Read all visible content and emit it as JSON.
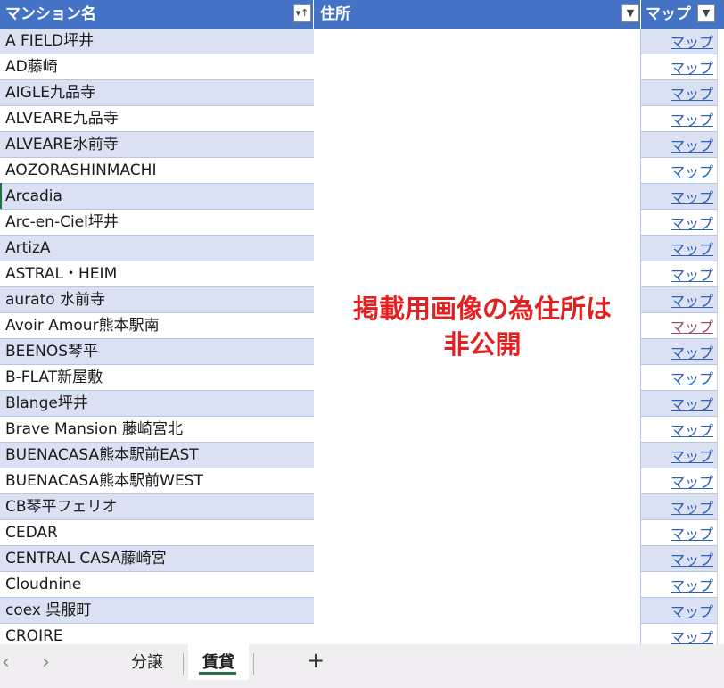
{
  "headers": {
    "name": "マンション名",
    "address": "住所",
    "map": "マップ"
  },
  "filter_icons": {
    "name": "filter-sort-ascending-icon",
    "address": "dropdown-arrow-icon",
    "map": "dropdown-arrow-icon"
  },
  "rows": [
    {
      "name": "A FIELD坪井",
      "map": "マップ"
    },
    {
      "name": "AD藤崎",
      "map": "マップ"
    },
    {
      "name": "AIGLE九品寺",
      "map": "マップ"
    },
    {
      "name": "ALVEARE九品寺",
      "map": "マップ"
    },
    {
      "name": "ALVEARE水前寺",
      "map": "マップ"
    },
    {
      "name": "AOZORASHINMACHI",
      "map": "マップ"
    },
    {
      "name": "Arcadia",
      "map": "マップ"
    },
    {
      "name": "Arc-en-Ciel坪井",
      "map": "マップ"
    },
    {
      "name": "ArtizA",
      "map": "マップ"
    },
    {
      "name": "ASTRAL・HEIM",
      "map": "マップ"
    },
    {
      "name": "aurato 水前寺",
      "map": "マップ"
    },
    {
      "name": "Avoir Amour熊本駅南",
      "map": "マップ",
      "visited": true
    },
    {
      "name": "BEENOS琴平",
      "map": "マップ"
    },
    {
      "name": "B-FLAT新屋敷",
      "map": "マップ"
    },
    {
      "name": "Blange坪井",
      "map": "マップ"
    },
    {
      "name": "Brave Mansion 藤崎宮北",
      "map": "マップ"
    },
    {
      "name": "BUENACASA熊本駅前EAST",
      "map": "マップ"
    },
    {
      "name": "BUENACASA熊本駅前WEST",
      "map": "マップ"
    },
    {
      "name": "CB琴平フェリオ",
      "map": "マップ"
    },
    {
      "name": "CEDAR",
      "map": "マップ"
    },
    {
      "name": "CENTRAL CASA藤崎宮",
      "map": "マップ"
    },
    {
      "name": "Cloudnine",
      "map": "マップ"
    },
    {
      "name": "coex 呉服町",
      "map": "マップ"
    },
    {
      "name": "CROIRE",
      "map": "マップ"
    }
  ],
  "overlay": {
    "line1": "掲載用画像の為住所は",
    "line2": "非公開"
  },
  "tabs": {
    "prev_icon": "chevron-left-icon",
    "next_icon": "chevron-right-icon",
    "prev_glyph": "‹",
    "next_glyph": "›",
    "sheet1": "分譲",
    "sheet2": "賃貸",
    "active": "賃貸",
    "add_glyph": "+",
    "add_icon": "plus-icon"
  },
  "colors": {
    "header_bg": "#4472c4",
    "band_bg": "#d9e1f2",
    "link": "#2f5fb8",
    "visited_link": "#954f72",
    "overlay_text": "#e32020",
    "active_tab_underline": "#217346"
  }
}
